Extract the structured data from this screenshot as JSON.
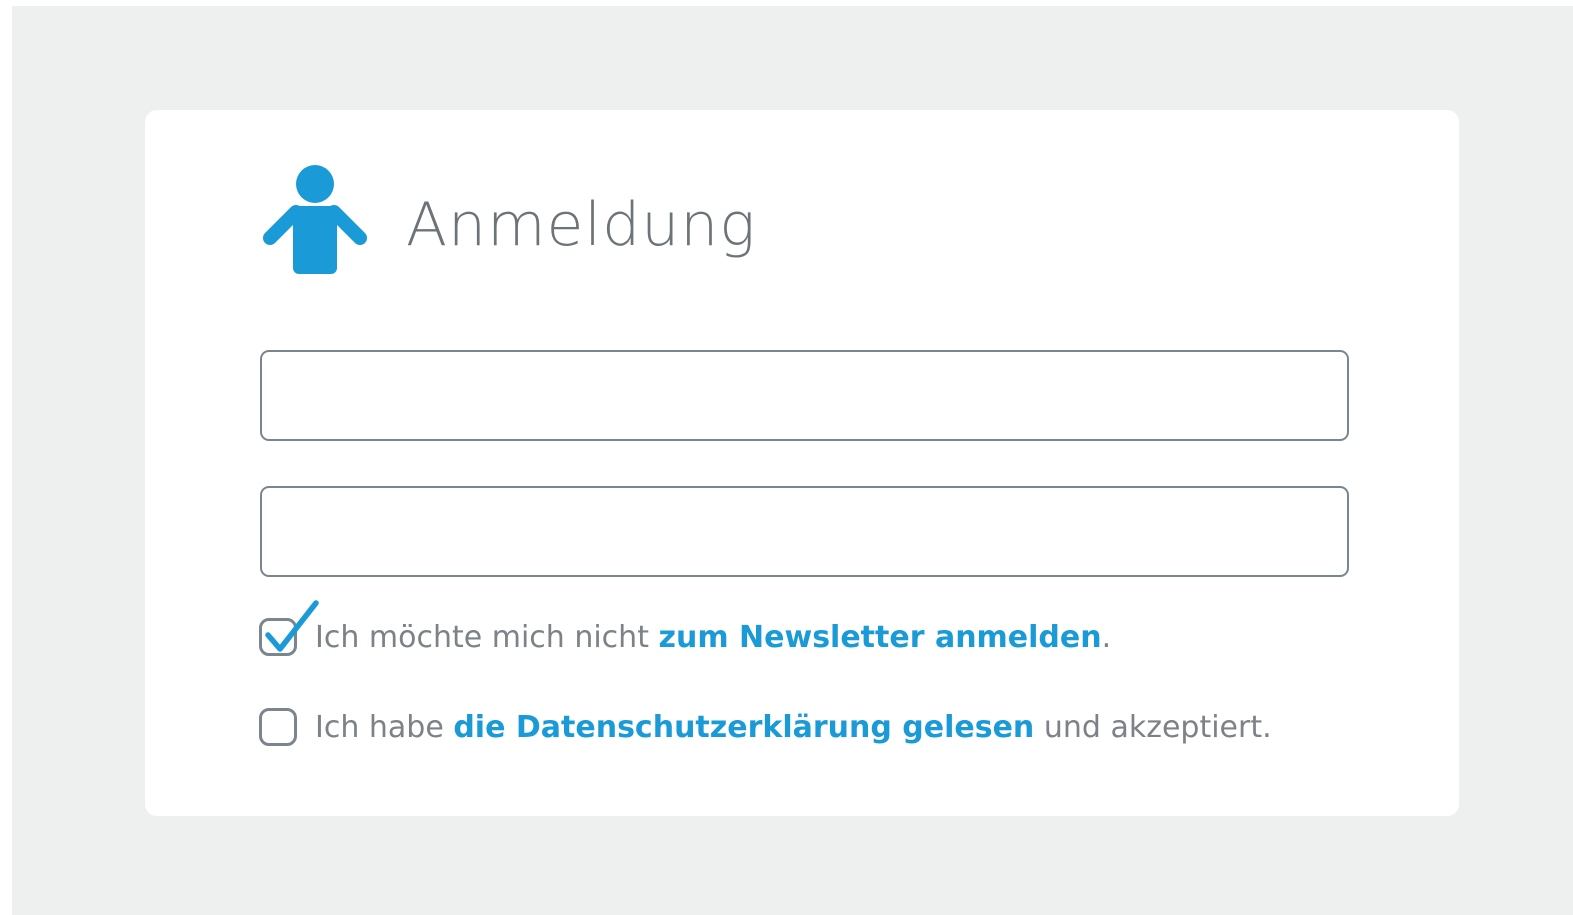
{
  "form": {
    "title": "Anmeldung",
    "fields": [
      {
        "value": "",
        "placeholder": ""
      },
      {
        "value": "",
        "placeholder": ""
      }
    ],
    "newsletter": {
      "checked": true,
      "text_before": "Ich möchte mich nicht ",
      "link_text": "zum Newsletter anmelden",
      "text_after": "."
    },
    "privacy": {
      "checked": false,
      "text_before": "Ich habe ",
      "link_text": "die Datenschutzerklärung gelesen",
      "text_after": " und akzeptiert."
    }
  },
  "icons": {
    "header_icon": "person-icon",
    "checked_icon": "checkmark-icon"
  },
  "colors": {
    "accent": "#1a9ad6",
    "page_background": "#eef0f0",
    "card_background": "#ffffff",
    "title_text": "#6d7479",
    "body_text": "#7c8287",
    "field_border": "#788690"
  }
}
